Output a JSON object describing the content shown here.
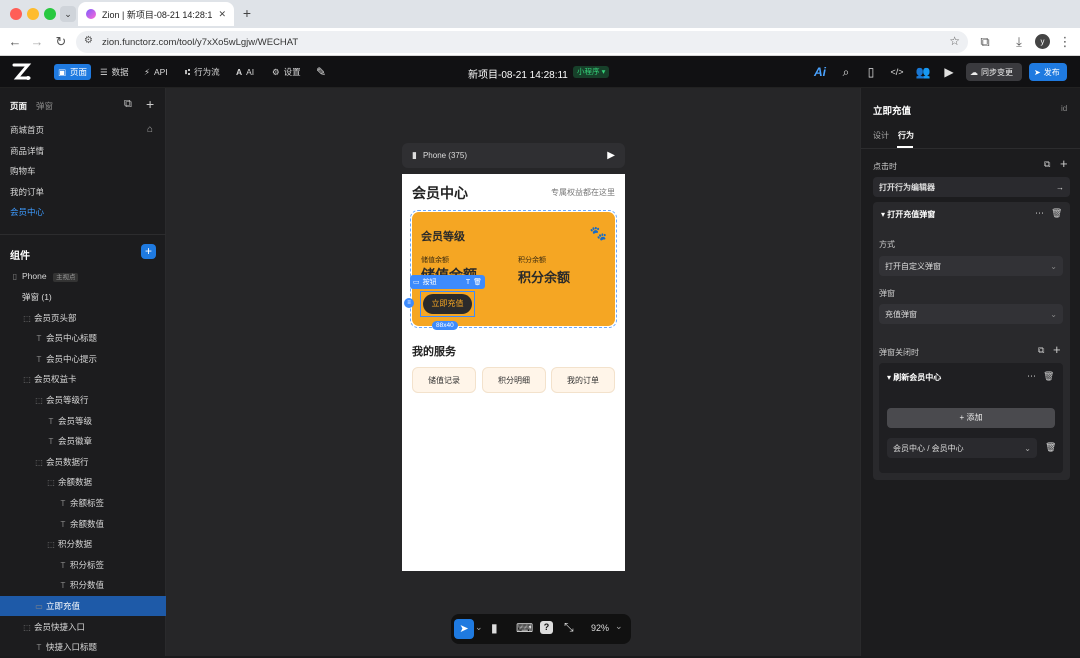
{
  "browser": {
    "tab_title": "Zion | 新项目-08-21 14:28:11",
    "url": "zion.functorz.com/tool/y7xXo5wLgjw/WECHAT",
    "profile_initial": "y"
  },
  "header": {
    "nav": [
      {
        "label": "页面",
        "icon": "page-icon",
        "active": true
      },
      {
        "label": "数据",
        "icon": "database-icon"
      },
      {
        "label": "API",
        "icon": "api-icon"
      },
      {
        "label": "行为流",
        "icon": "flow-icon"
      },
      {
        "label": "AI",
        "icon": "ai-icon"
      },
      {
        "label": "设置",
        "icon": "gear-icon"
      }
    ],
    "project_title": "新项目-08-21 14:28:11",
    "platform_badge": "小程序",
    "sync_label": "同步变更",
    "publish_label": "发布"
  },
  "left": {
    "tabs": [
      "页面",
      "弹窗"
    ],
    "pages": [
      "商城首页",
      "商品详情",
      "购物车",
      "我的订单",
      "会员中心"
    ],
    "components_title": "组件",
    "phone_label": "Phone",
    "phone_badge": "主视点",
    "tree": [
      {
        "label": "弹窗 (1)",
        "depth": 0,
        "type": "none"
      },
      {
        "label": "会员页头部",
        "depth": 0,
        "type": "box"
      },
      {
        "label": "会员中心标题",
        "depth": 1,
        "type": "text"
      },
      {
        "label": "会员中心提示",
        "depth": 1,
        "type": "text"
      },
      {
        "label": "会员权益卡",
        "depth": 0,
        "type": "box"
      },
      {
        "label": "会员等级行",
        "depth": 1,
        "type": "box"
      },
      {
        "label": "会员等级",
        "depth": 2,
        "type": "text"
      },
      {
        "label": "会员徽章",
        "depth": 2,
        "type": "text"
      },
      {
        "label": "会员数据行",
        "depth": 1,
        "type": "box"
      },
      {
        "label": "余额数据",
        "depth": 2,
        "type": "box"
      },
      {
        "label": "余额标签",
        "depth": 3,
        "type": "text"
      },
      {
        "label": "余额数值",
        "depth": 3,
        "type": "text"
      },
      {
        "label": "积分数据",
        "depth": 2,
        "type": "box"
      },
      {
        "label": "积分标签",
        "depth": 3,
        "type": "text"
      },
      {
        "label": "积分数值",
        "depth": 3,
        "type": "text"
      },
      {
        "label": "立即充值",
        "depth": 1,
        "type": "button",
        "selected": true
      },
      {
        "label": "会员快捷入口",
        "depth": 0,
        "type": "box"
      },
      {
        "label": "快捷入口标题",
        "depth": 1,
        "type": "text"
      }
    ]
  },
  "canvas": {
    "device_label": "Phone (375)",
    "page": {
      "title": "会员中心",
      "hint": "专属权益都在这里",
      "card_title": "会员等级",
      "balance_label": "储值余额",
      "balance_value": "储值余额",
      "points_label": "积分余额",
      "points_value": "积分余额",
      "cta": "立即充值",
      "services_title": "我的服务",
      "services": [
        "储值记录",
        "积分明细",
        "我的订单"
      ]
    },
    "selection_tag": "按钮",
    "selection_size": "88x40",
    "zoom": "92%"
  },
  "right": {
    "title": "立即充值",
    "id_label": "id",
    "tabs": [
      "设计",
      "行为"
    ],
    "on_click": "点击时",
    "open_editor": "打开行为编辑器",
    "action_title": "打开充值弹窗",
    "mode_label": "方式",
    "mode_value": "打开自定义弹窗",
    "popup_label": "弹窗",
    "popup_value": "充值弹窗",
    "on_close": "弹窗关闭时",
    "refresh_title": "刷新会员中心",
    "add_label": "添加",
    "target_value": "会员中心 / 会员中心"
  },
  "colors": {
    "accent": "#1f7ae0",
    "card": "#f5a623",
    "cta": "#2b2b2b"
  }
}
